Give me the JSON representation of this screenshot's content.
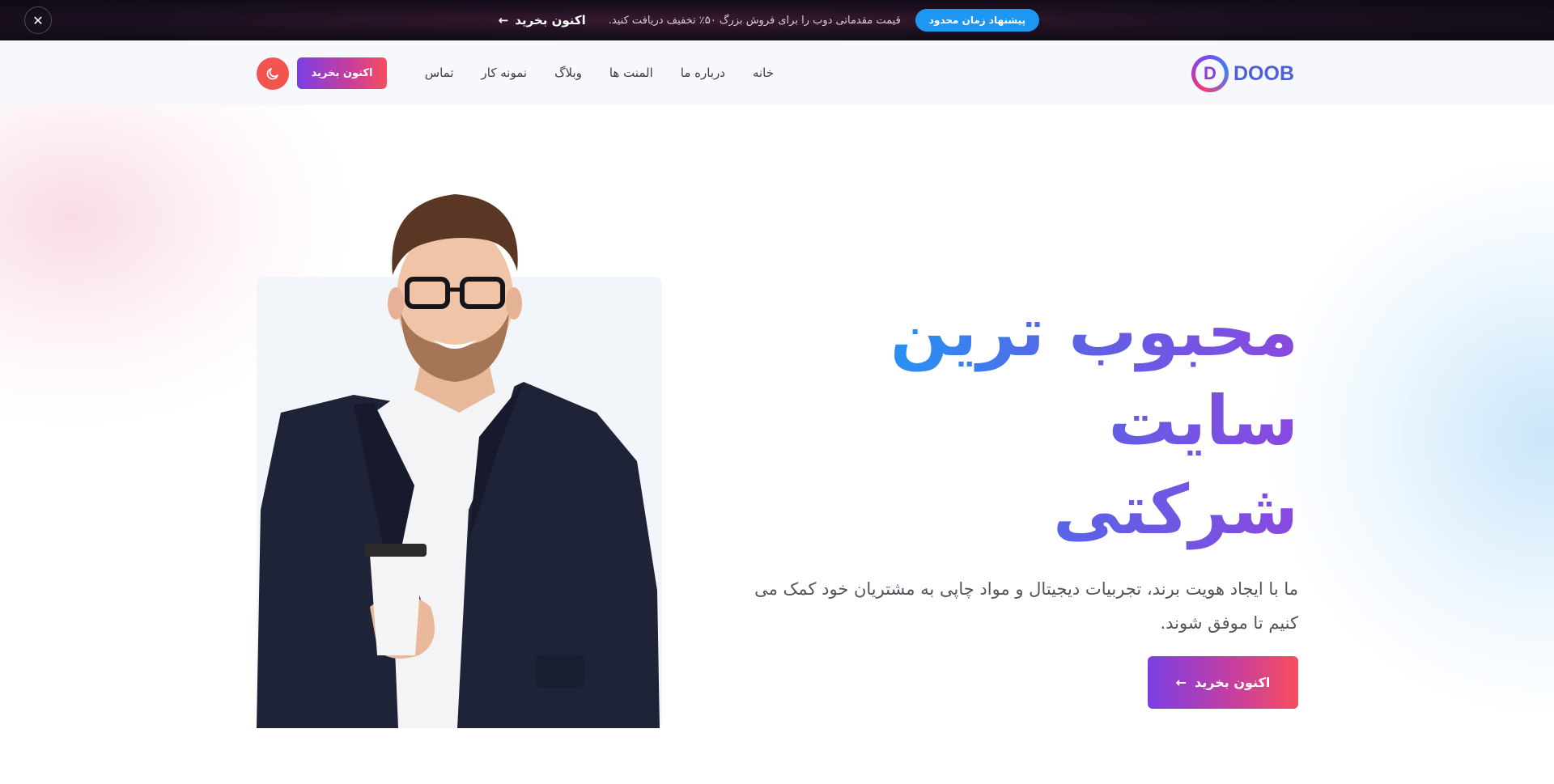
{
  "promo": {
    "badge": "پیشنهاد زمان محدود",
    "text": "قیمت مقدماتی دوب را برای فروش بزرگ ۵۰٪ تخفیف دریافت کنید.",
    "link": "اکنون بخرید",
    "link_icon": "arrow-left-icon",
    "close_icon": "close-icon"
  },
  "header": {
    "logo_text": "DOOB",
    "logo_letter": "D",
    "nav": [
      {
        "label": "خانه"
      },
      {
        "label": "درباره ما"
      },
      {
        "label": "المنت ها"
      },
      {
        "label": "وبلاگ"
      },
      {
        "label": "نمونه کار"
      },
      {
        "label": "تماس"
      }
    ],
    "buy_label": "اکنون بخرید",
    "theme_icon": "moon-icon"
  },
  "hero": {
    "title_line1": "محبوب ترین سایت",
    "title_line2": "شرکتی",
    "description": "ما با ایجاد هویت برند، تجربیات دیجیتال و مواد چاپی به مشتریان خود کمک می کنیم تا موفق شوند.",
    "cta_label": "اکنون بخرید",
    "cta_icon": "arrow-left-icon"
  },
  "colors": {
    "accent_blue": "#1e97f3",
    "gradient_start": "#7b3fe4",
    "gradient_end": "#f74e5e",
    "theme_toggle": "#f3544f"
  }
}
